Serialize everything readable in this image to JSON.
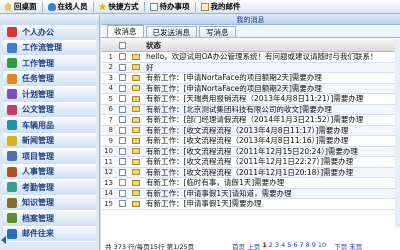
{
  "toolbar": {
    "items": [
      {
        "label": "回桌面",
        "icon": "home-icon"
      },
      {
        "label": "在线人员",
        "icon": "users-icon"
      },
      {
        "label": "快捷方式",
        "icon": "star-icon"
      },
      {
        "label": "待办事项",
        "icon": "todo-icon"
      },
      {
        "label": "我的邮件",
        "icon": "mail-icon"
      }
    ]
  },
  "sidebar": {
    "items": [
      {
        "label": "个人办公",
        "color": "#d23b2f"
      },
      {
        "label": "工作流管理",
        "color": "#3a7fd0"
      },
      {
        "label": "工作管理",
        "color": "#2e9a45"
      },
      {
        "label": "任务管理",
        "color": "#e08a1e"
      },
      {
        "label": "计划管理",
        "color": "#7a4fc1"
      },
      {
        "label": "公文管理",
        "color": "#c23b6b"
      },
      {
        "label": "车辆用品",
        "color": "#1f8fb0"
      },
      {
        "label": "新闻管理",
        "color": "#d8b21c"
      },
      {
        "label": "项目管理",
        "color": "#4a6fb5"
      },
      {
        "label": "人事管理",
        "color": "#b5512a"
      },
      {
        "label": "考勤管理",
        "color": "#3b9c8a"
      },
      {
        "label": "知识管理",
        "color": "#8a6a2a"
      },
      {
        "label": "档案管理",
        "color": "#5a8f2a"
      },
      {
        "label": "邮件往来",
        "color": "#2a6fb5"
      }
    ]
  },
  "main": {
    "title": "我的消息",
    "tabs": [
      "收消息",
      "已发送消息",
      "写消息"
    ],
    "active_tab": 0,
    "header": {
      "status": "状态"
    },
    "rows": [
      {
        "n": "1",
        "text": "hello，欢迎试用OA办公管理系统！有问题或建议请随时与我们联系！"
      },
      {
        "n": "2",
        "text": "好"
      },
      {
        "n": "3",
        "text": "有新工作：[申请NortaFace的项目额期2天]需要办理"
      },
      {
        "n": "4",
        "text": "有新工作：[申请NortaFace的项目额期2天]需要办理"
      },
      {
        "n": "5",
        "text": "有新工作：[天瑞费用报销流程（2013年4月8日11:21）]需要办理"
      },
      {
        "n": "6",
        "text": "有新工作：[北京测试集团科技有限公司的收文]需要办理"
      },
      {
        "n": "7",
        "text": "有新工作：[部门经理请假流程（2014年1月3日21:52）]需要办理"
      },
      {
        "n": "8",
        "text": "有新工作：[收文流程流程（2013年4月8日11:17）]需要办理"
      },
      {
        "n": "9",
        "text": "有新工作：[收文流程流程（2013年4月8日11:16）]需要办理"
      },
      {
        "n": "10",
        "text": "有新工作：[收文流程流程（2011年12月15日20:24）]需要办理"
      },
      {
        "n": "11",
        "text": "有新工作：[收文流程流程（2011年12月1日22:27）]需要办理"
      },
      {
        "n": "12",
        "text": "有新工作：[收文流程流程（2011年12月1日20:18）]需要办理"
      },
      {
        "n": "13",
        "text": "有新工作：[临时有事，请假1天]需要办理"
      },
      {
        "n": "14",
        "text": "有新工作：[申请事假1天]请知道，需要办理"
      },
      {
        "n": "15",
        "text": "有新工作：[申请事假1天]需要办理"
      }
    ],
    "footer": {
      "stats": "共 373 行/每页15行 第1/25页",
      "pages_prefix": "首页 上页",
      "pages": [
        "1",
        "2",
        "3",
        "4",
        "5",
        "6",
        "7",
        "8",
        "9",
        "10"
      ],
      "current_page": "1",
      "next": "下页 末页"
    }
  }
}
